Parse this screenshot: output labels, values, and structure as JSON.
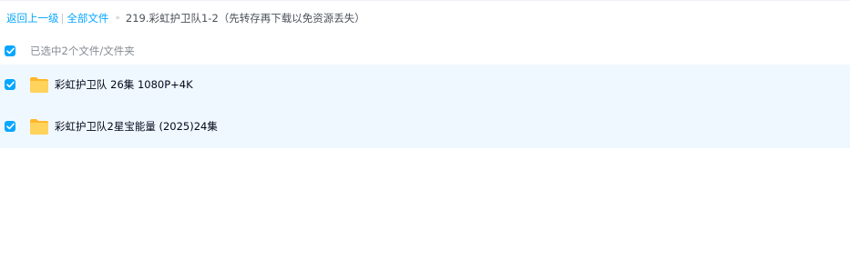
{
  "breadcrumb": {
    "back_label": "返回上一级",
    "separator": "|",
    "all_files_label": "全部文件",
    "arrow": "»",
    "current_folder": "219.彩虹护卫队1-2（先转存再下载以免资源丢失）"
  },
  "selection": {
    "checked": true,
    "summary": "已选中2个文件/文件夹"
  },
  "files": [
    {
      "name": "彩虹护卫队 26集 1080P+4K",
      "type": "folder",
      "checked": true
    },
    {
      "name": "彩虹护卫队2星宝能量 (2025)24集",
      "type": "folder",
      "checked": true
    }
  ],
  "colors": {
    "accent": "#06a7ff",
    "selected_row_bg": "#f0f8ff",
    "folder_yellow": "#ffc53d"
  }
}
